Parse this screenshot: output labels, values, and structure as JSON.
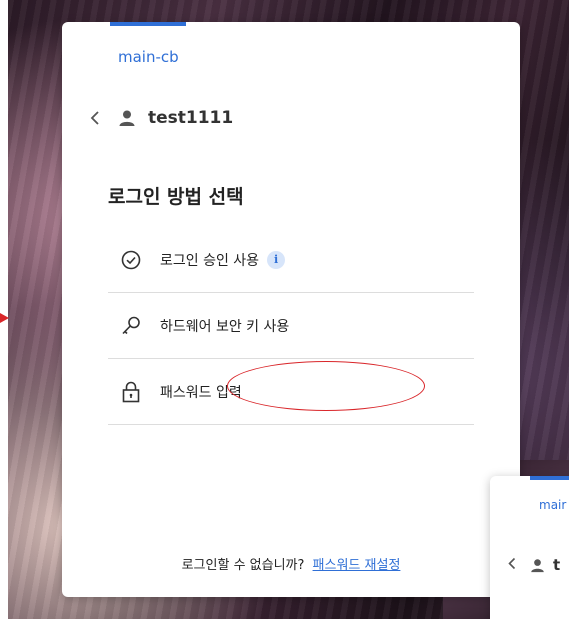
{
  "login_card": {
    "tenant": "main-cb",
    "username": "test1111",
    "heading": "로그인 방법 선택",
    "options": [
      {
        "label": "로그인 승인 사용",
        "icon": "check-circle-icon",
        "has_info": true,
        "info_glyph": "i"
      },
      {
        "label": "하드웨어 보안 키 사용",
        "icon": "key-icon",
        "has_info": false
      },
      {
        "label": "패스워드 입력",
        "icon": "lock-icon",
        "has_info": false
      }
    ],
    "footer_text": "로그인할 수 없습니까?",
    "footer_link": "패스워드 재설정"
  },
  "second_card": {
    "tenant": "mair",
    "username_fragment": "t"
  },
  "colors": {
    "accent": "#2f6fd6",
    "annotation": "#d9262a"
  }
}
